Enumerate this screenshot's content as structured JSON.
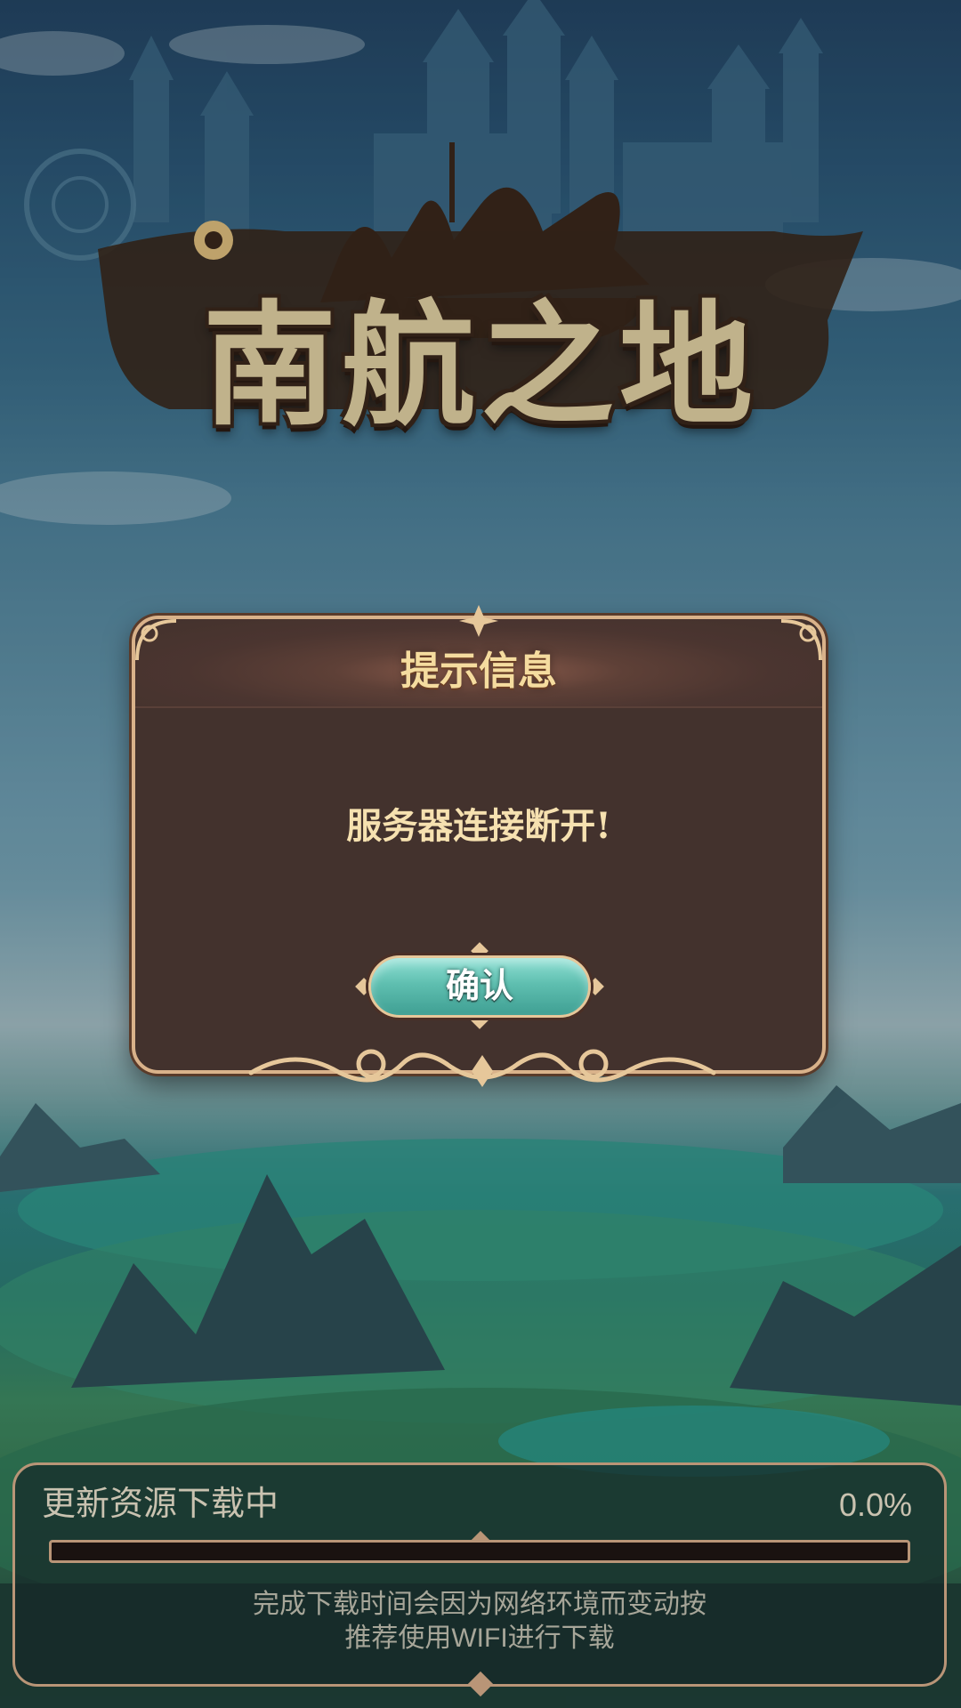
{
  "game": {
    "logo_text": "南航之地",
    "icon": "ship-logo-icon"
  },
  "dialog": {
    "title": "提示信息",
    "message": "服务器连接断开!",
    "confirm_label": "确认"
  },
  "download": {
    "status_label": "更新资源下载中",
    "percent_text": "0.0%",
    "progress": 0.0,
    "note_line1": "完成下载时间会因为网络环境而变动按",
    "note_line2": "推荐使用WIFI进行下载"
  },
  "colors": {
    "dialog_bg": "#43322d",
    "dialog_border": "#d9b28a",
    "title_text": "#f5dc9f",
    "button_teal": "#5fbfb0",
    "panel_border": "#b99577"
  }
}
